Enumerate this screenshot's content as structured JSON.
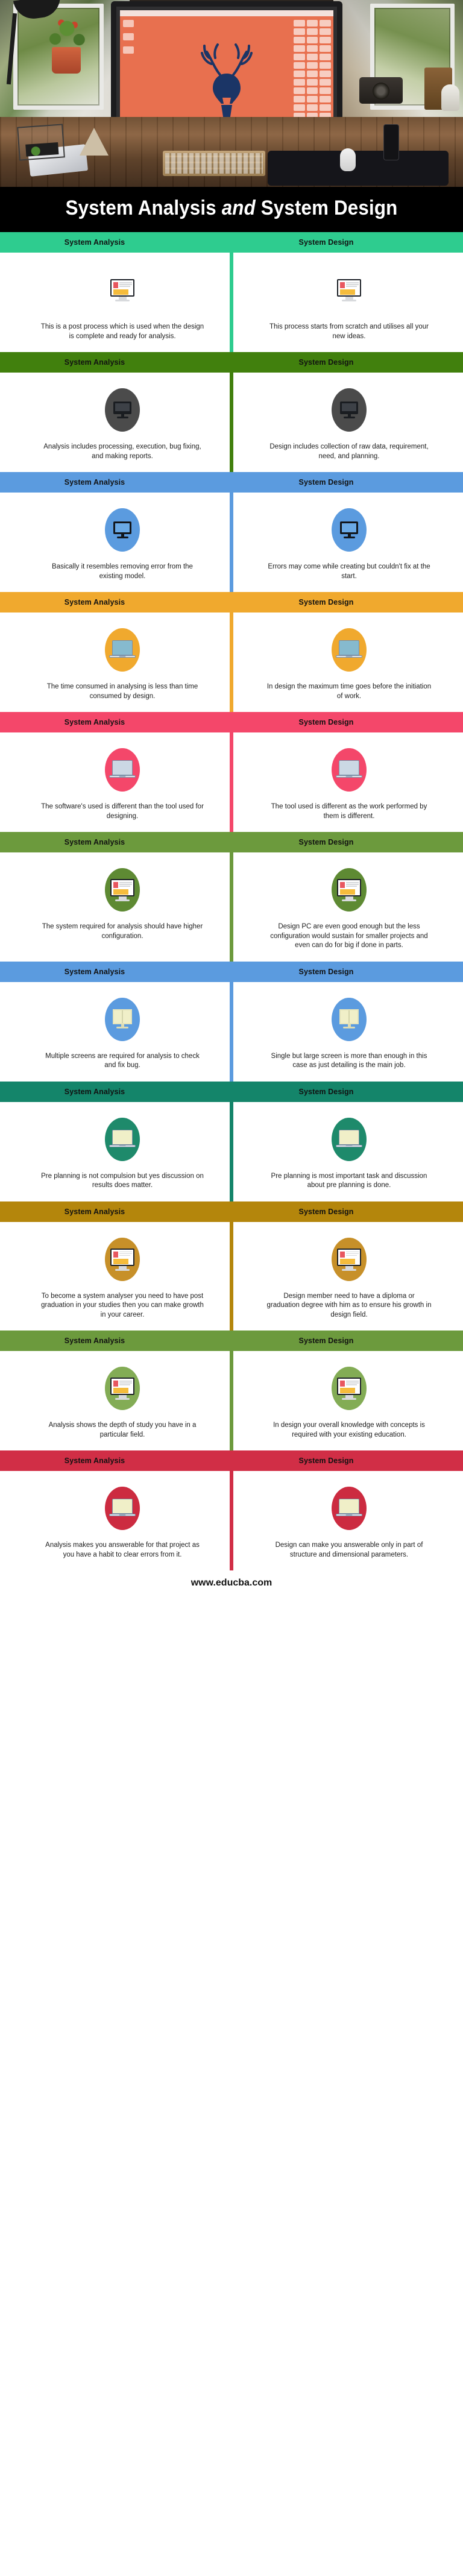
{
  "hero": {
    "alt": "imac-on-wooden-desk-photo"
  },
  "title": {
    "part1": "System Analysis ",
    "emphasis": "and",
    "part2": "  System Design"
  },
  "columns": {
    "left_label": "System Analysis",
    "right_label": "System Design"
  },
  "colors": {
    "row1": "#2ECC8F",
    "row2": "#41800D",
    "row3": "#5B9BDF",
    "row4": "#F0A92E",
    "row5": "#F4476A",
    "row6": "#6C9A3D",
    "row7": "#5B9BDF",
    "row8": "#14856A",
    "row9": "#B4860C",
    "row10": "#6C9A3D",
    "row11": "#D12E46",
    "title_bg": "#000000",
    "page_bg": "#FFFFFF",
    "body_text": "#1C1C1C",
    "header_text": "#111111"
  },
  "rows": [
    {
      "band_color": "#2ECC8F",
      "icon": "monitor-document-icon",
      "icon_style": "plain",
      "left_text": "This is a post process which is used when the design is complete and ready for analysis.",
      "right_text": "This process starts from scratch and utilises all your new ideas."
    },
    {
      "band_color": "#41800D",
      "icon": "monitor-dark-icon",
      "icon_style": "circle-gray",
      "circle_color": "#4B4B4B",
      "left_text": "Analysis includes processing, execution, bug fixing, and making reports.",
      "right_text": "Design includes collection of raw data, requirement, need, and planning."
    },
    {
      "band_color": "#5B9BDF",
      "icon": "monitor-blue-screen-icon",
      "icon_style": "circle",
      "circle_color": "#5B9BDF",
      "left_text": "Basically it resembles removing error from the existing model.",
      "right_text": "Errors may come while creating but couldn't fix at the start."
    },
    {
      "band_color": "#F0A92E",
      "icon": "laptop-icon",
      "icon_style": "circle",
      "circle_color": "#F0A92E",
      "laptop_screen": "#86BACE",
      "left_text": "The time consumed in analysing is less than time consumed by design.",
      "right_text": "In design the maximum time goes before the initiation of work."
    },
    {
      "band_color": "#F4476A",
      "icon": "laptop-icon",
      "icon_style": "circle",
      "circle_color": "#F4476A",
      "laptop_screen": "#CBD8E4",
      "left_text": "The software's used is different than the tool used for designing.",
      "right_text": "The tool used is different as the work performed by them is different."
    },
    {
      "band_color": "#6C9A3D",
      "icon": "monitor-document-icon",
      "icon_style": "circle",
      "circle_color": "#5E8A33",
      "left_text": "The system required for analysis should have higher configuration.",
      "right_text": "Design PC are even good enough but the less configuration would sustain for smaller projects and even can do for big if done in parts."
    },
    {
      "band_color": "#5B9BDF",
      "icon": "book-screen-icon",
      "icon_style": "circle",
      "circle_color": "#5B9BDF",
      "left_text": "Multiple screens are required for analysis to check and fix bug.",
      "right_text": "Single but large screen is more than enough in this case as just detailing is the main job."
    },
    {
      "band_color": "#14856A",
      "icon": "laptop-book-icon",
      "icon_style": "circle",
      "circle_color": "#1E8A6B",
      "laptop_screen": "#F0EFC8",
      "left_text": "Pre planning is not compulsion but yes discussion on results does matter.",
      "right_text": "Pre planning is most important task and discussion about pre planning is done."
    },
    {
      "band_color": "#B4860C",
      "icon": "monitor-document-icon",
      "icon_style": "circle",
      "circle_color": "#C79029",
      "left_text": "To become a system analyser you need to have post graduation in your studies then you can make growth in your career.",
      "right_text": "Design member need to have a diploma or graduation degree with him as to ensure his growth in design field."
    },
    {
      "band_color": "#6C9A3D",
      "icon": "monitor-document-icon",
      "icon_style": "circle",
      "circle_color": "#83AC55",
      "left_text": "Analysis shows the depth of study you have in a particular field.",
      "right_text": "In design your overall knowledge with concepts is required with your existing education."
    },
    {
      "band_color": "#D12E46",
      "icon": "laptop-book-icon",
      "icon_style": "circle",
      "circle_color": "#CC2B40",
      "laptop_screen": "#F0EFC8",
      "left_text": "Analysis makes you answerable for that project as you have a habit to clear errors from it.",
      "right_text": "Design can make you answerable only in part of structure and dimensional parameters."
    }
  ],
  "footer": {
    "url": "www.educba.com"
  }
}
